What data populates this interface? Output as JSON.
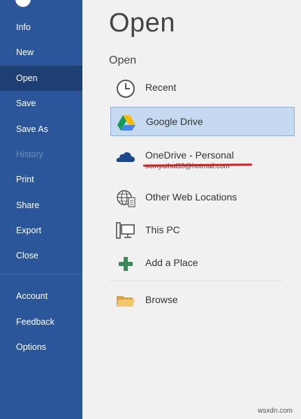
{
  "nav": {
    "items": [
      {
        "label": "Info",
        "state": "normal"
      },
      {
        "label": "New",
        "state": "normal"
      },
      {
        "label": "Open",
        "state": "active"
      },
      {
        "label": "Save",
        "state": "normal"
      },
      {
        "label": "Save As",
        "state": "normal"
      },
      {
        "label": "History",
        "state": "disabled"
      },
      {
        "label": "Print",
        "state": "normal"
      },
      {
        "label": "Share",
        "state": "normal"
      },
      {
        "label": "Export",
        "state": "normal"
      },
      {
        "label": "Close",
        "state": "normal"
      },
      {
        "label": "Account",
        "state": "normal"
      },
      {
        "label": "Feedback",
        "state": "normal"
      },
      {
        "label": "Options",
        "state": "normal"
      }
    ]
  },
  "main": {
    "title": "Open",
    "section_title": "Open",
    "places": [
      {
        "label": "Recent",
        "icon": "clock-icon"
      },
      {
        "label": "Google Drive",
        "icon": "google-drive-icon",
        "selected": true
      },
      {
        "label": "OneDrive - Personal",
        "sub": "somyathal55@hotmail.com",
        "icon": "onedrive-cloud-icon",
        "sub_redacted": true
      },
      {
        "label": "Other Web Locations",
        "icon": "globe-icon"
      },
      {
        "label": "This PC",
        "icon": "computer-icon"
      },
      {
        "label": "Add a Place",
        "icon": "plus-icon"
      },
      {
        "label": "Browse",
        "icon": "folder-icon"
      }
    ]
  },
  "watermark": "wsxdn.com",
  "colors": {
    "sidebar": "#2b579a",
    "sidebar_active": "#1e3f73",
    "selected_bg": "#c5d9f1",
    "redaction": "#e0191e"
  }
}
